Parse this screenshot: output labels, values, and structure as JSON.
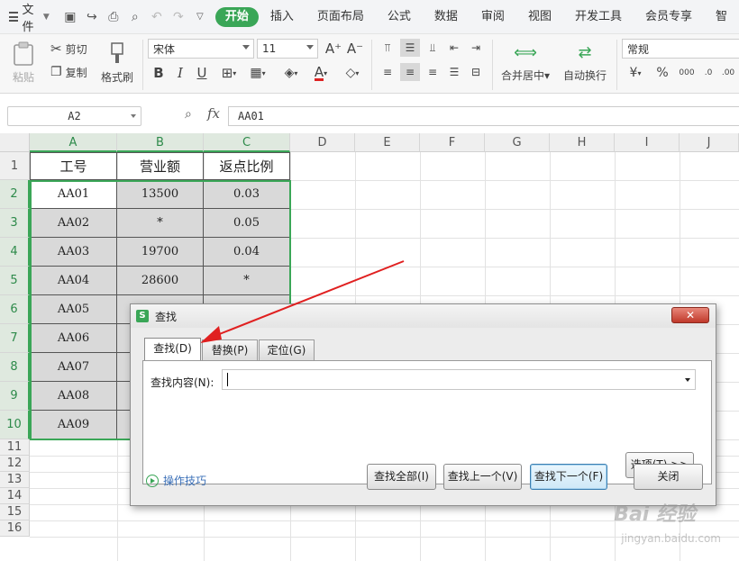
{
  "menubar": {
    "file_label": "文件",
    "tabs": [
      "开始",
      "插入",
      "页面布局",
      "公式",
      "数据",
      "审阅",
      "视图",
      "开发工具",
      "会员专享",
      "智"
    ]
  },
  "ribbon": {
    "paste": "粘贴",
    "cut": "剪切",
    "copy": "复制",
    "format_painter": "格式刷",
    "font_name": "宋体",
    "font_size": "11",
    "merge_center": "合并居中",
    "wrap_text": "自动换行",
    "number_format": "常规",
    "currency_symbol": "¥",
    "percent_symbol": "%",
    "thousands": "000"
  },
  "formula_bar": {
    "name_box": "A2",
    "fx": "fx",
    "content": "AA01"
  },
  "grid": {
    "columns": [
      "A",
      "B",
      "C",
      "D",
      "E",
      "F",
      "G",
      "H",
      "I",
      "J"
    ],
    "rows": [
      "1",
      "2",
      "3",
      "4",
      "5",
      "6",
      "7",
      "8",
      "9",
      "10",
      "11",
      "12",
      "13",
      "14",
      "15",
      "16"
    ],
    "headers": [
      "工号",
      "营业额",
      "返点比例"
    ],
    "data": [
      [
        "AA01",
        "13500",
        "0.03"
      ],
      [
        "AA02",
        "*",
        "0.05"
      ],
      [
        "AA03",
        "19700",
        "0.04"
      ],
      [
        "AA04",
        "28600",
        "*"
      ],
      [
        "AA05",
        "",
        ""
      ],
      [
        "AA06",
        "",
        ""
      ],
      [
        "AA07",
        "",
        ""
      ],
      [
        "AA08",
        "",
        ""
      ],
      [
        "AA09",
        "",
        ""
      ]
    ]
  },
  "dialog": {
    "title": "查找",
    "close_x": "✕",
    "tabs": [
      "查找(D)",
      "替换(P)",
      "定位(G)"
    ],
    "find_label": "查找内容(N):",
    "find_value": "",
    "options_button": "选项(T) >>",
    "tips_link": "操作技巧",
    "find_all": "查找全部(I)",
    "find_prev": "查找上一个(V)",
    "find_next": "查找下一个(F)",
    "close_button": "关闭"
  },
  "watermark": {
    "main": "Bai 经验",
    "url": "jingyan.baidu.com"
  },
  "colors": {
    "accent": "#3aa657",
    "arrow": "#e02020",
    "selection_shade": "#d9d9d9"
  }
}
